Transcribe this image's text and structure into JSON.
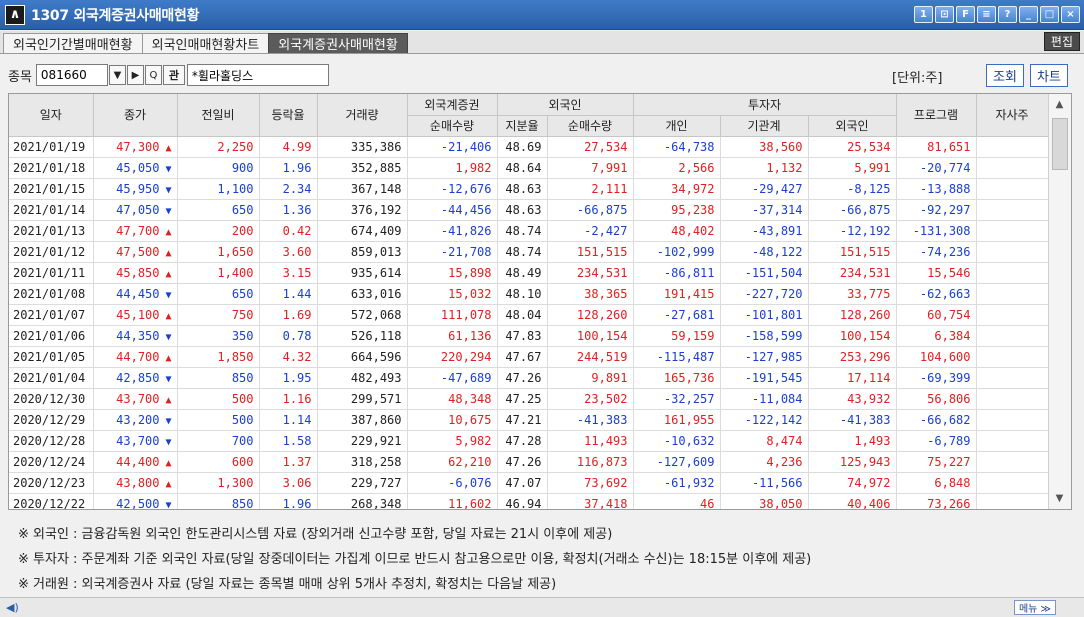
{
  "window": {
    "screen_no": "1307",
    "title": "외국계증권사매매현황",
    "logo": "∧"
  },
  "title_buttons": [
    "1",
    "⊡",
    "F",
    "≡",
    "?",
    "_",
    "□",
    "×"
  ],
  "tabs": [
    {
      "label": "외국인기간별매매현황",
      "active": false
    },
    {
      "label": "외국인매매현황차트",
      "active": false
    },
    {
      "label": "외국계증권사매매현황",
      "active": true
    }
  ],
  "edit_label": "편집",
  "search": {
    "label": "종목",
    "code": "081660",
    "stock_name": "*휠라홀딩스",
    "dropdown_glyph": "▼",
    "next_glyph": "▶",
    "search_glyph": "Q",
    "link_glyph": "관"
  },
  "unit_label": "[단위:주]",
  "query_button": "조회",
  "chart_button": "차트",
  "headers": {
    "date": "일자",
    "close": "종가",
    "change": "전일비",
    "rate": "등락율",
    "volume": "거래량",
    "foreign_broker": "외국계증권",
    "foreign_broker_net": "순매수량",
    "foreigner": "외국인",
    "holding": "지분율",
    "foreigner_net": "순매수량",
    "investor": "투자자",
    "individual": "개인",
    "institution": "기관계",
    "investor_foreigner": "외국인",
    "program": "프로그램",
    "self": "자사주"
  },
  "colors": {
    "up": "#e02020",
    "down": "#1a3fd0"
  },
  "rows": [
    [
      "2021/01/19",
      "47,300",
      "up",
      "2,250",
      "4.99",
      "335,386",
      "-21,406",
      "48.69",
      "27,534",
      "-64,738",
      "38,560",
      "25,534",
      "81,651"
    ],
    [
      "2021/01/18",
      "45,050",
      "down",
      "900",
      "1.96",
      "352,885",
      "1,982",
      "48.64",
      "7,991",
      "2,566",
      "1,132",
      "5,991",
      "-20,774"
    ],
    [
      "2021/01/15",
      "45,950",
      "down",
      "1,100",
      "2.34",
      "367,148",
      "-12,676",
      "48.63",
      "2,111",
      "34,972",
      "-29,427",
      "-8,125",
      "-13,888"
    ],
    [
      "2021/01/14",
      "47,050",
      "down",
      "650",
      "1.36",
      "376,192",
      "-44,456",
      "48.63",
      "-66,875",
      "95,238",
      "-37,314",
      "-66,875",
      "-92,297"
    ],
    [
      "2021/01/13",
      "47,700",
      "up",
      "200",
      "0.42",
      "674,409",
      "-41,826",
      "48.74",
      "-2,427",
      "48,402",
      "-43,891",
      "-12,192",
      "-131,308"
    ],
    [
      "2021/01/12",
      "47,500",
      "up",
      "1,650",
      "3.60",
      "859,013",
      "-21,708",
      "48.74",
      "151,515",
      "-102,999",
      "-48,122",
      "151,515",
      "-74,236"
    ],
    [
      "2021/01/11",
      "45,850",
      "up",
      "1,400",
      "3.15",
      "935,614",
      "15,898",
      "48.49",
      "234,531",
      "-86,811",
      "-151,504",
      "234,531",
      "15,546"
    ],
    [
      "2021/01/08",
      "44,450",
      "down",
      "650",
      "1.44",
      "633,016",
      "15,032",
      "48.10",
      "38,365",
      "191,415",
      "-227,720",
      "33,775",
      "-62,663"
    ],
    [
      "2021/01/07",
      "45,100",
      "up",
      "750",
      "1.69",
      "572,068",
      "111,078",
      "48.04",
      "128,260",
      "-27,681",
      "-101,801",
      "128,260",
      "60,754"
    ],
    [
      "2021/01/06",
      "44,350",
      "down",
      "350",
      "0.78",
      "526,118",
      "61,136",
      "47.83",
      "100,154",
      "59,159",
      "-158,599",
      "100,154",
      "6,384"
    ],
    [
      "2021/01/05",
      "44,700",
      "up",
      "1,850",
      "4.32",
      "664,596",
      "220,294",
      "47.67",
      "244,519",
      "-115,487",
      "-127,985",
      "253,296",
      "104,600"
    ],
    [
      "2021/01/04",
      "42,850",
      "down",
      "850",
      "1.95",
      "482,493",
      "-47,689",
      "47.26",
      "9,891",
      "165,736",
      "-191,545",
      "17,114",
      "-69,399"
    ],
    [
      "2020/12/30",
      "43,700",
      "up",
      "500",
      "1.16",
      "299,571",
      "48,348",
      "47.25",
      "23,502",
      "-32,257",
      "-11,084",
      "43,932",
      "56,806"
    ],
    [
      "2020/12/29",
      "43,200",
      "down",
      "500",
      "1.14",
      "387,860",
      "10,675",
      "47.21",
      "-41,383",
      "161,955",
      "-122,142",
      "-41,383",
      "-66,682"
    ],
    [
      "2020/12/28",
      "43,700",
      "down",
      "700",
      "1.58",
      "229,921",
      "5,982",
      "47.28",
      "11,493",
      "-10,632",
      "8,474",
      "1,493",
      "-6,789"
    ],
    [
      "2020/12/24",
      "44,400",
      "up",
      "600",
      "1.37",
      "318,258",
      "62,210",
      "47.26",
      "116,873",
      "-127,609",
      "4,236",
      "125,943",
      "75,227"
    ],
    [
      "2020/12/23",
      "43,800",
      "up",
      "1,300",
      "3.06",
      "229,727",
      "-6,076",
      "47.07",
      "73,692",
      "-61,932",
      "-11,566",
      "74,972",
      "6,848"
    ],
    [
      "2020/12/22",
      "42,500",
      "down",
      "850",
      "1.96",
      "268,348",
      "11,602",
      "46.94",
      "37,418",
      "46",
      "38,050",
      "40,406",
      "73,266"
    ]
  ],
  "scroll": {
    "up": "▲",
    "down": "▼"
  },
  "notes": [
    "※ 외국인 : 금융감독원 외국인 한도관리시스템 자료 (장외거래 신고수량 포함, 당일 자료는 21시 이후에 제공)",
    "※ 투자자 : 주문계좌 기준 외국인 자료(당일 장중데이터는 가집계 이므로 반드시 참고용으로만 이용, 확정치(거래소 수신)는 18:15분 이후에 제공)",
    "※ 거래원 : 외국계증권사 자료 (당일 자료는 종목별 매매 상위 5개사 추정치, 확정치는 다음날 제공)"
  ],
  "status": {
    "speaker": "◀)",
    "menu_label": "메뉴 ≫"
  }
}
